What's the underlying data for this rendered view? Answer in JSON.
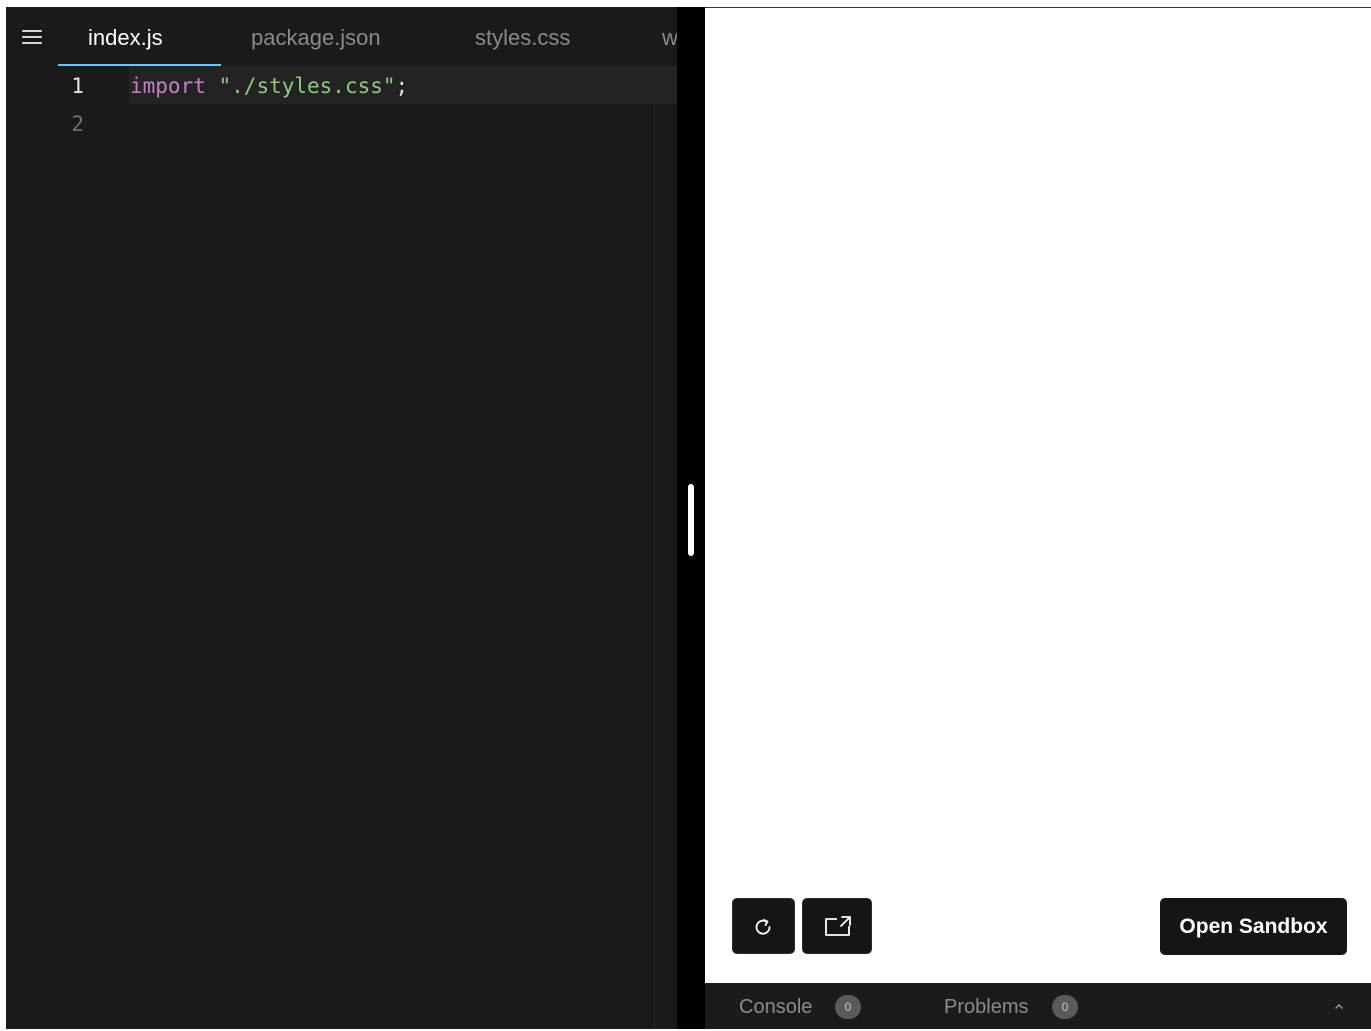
{
  "editor": {
    "tabs": [
      {
        "label": "index.js",
        "active": true
      },
      {
        "label": "package.json",
        "active": false
      },
      {
        "label": "styles.css",
        "active": false
      },
      {
        "label": "w",
        "active": false
      }
    ],
    "line_numbers": [
      "1",
      "2"
    ],
    "code": {
      "line1_keyword": "import",
      "line1_string": "\"./styles.css\"",
      "line1_punct": ";"
    }
  },
  "preview": {
    "refresh_icon": "refresh-icon",
    "new_window_icon": "open-new-window-icon",
    "open_sandbox_label": "Open Sandbox"
  },
  "bottom_bar": {
    "console_label": "Console",
    "console_count": "0",
    "problems_label": "Problems",
    "problems_count": "0",
    "toggle_icon": "chevron-up-icon"
  },
  "colors": {
    "editor_bg": "#1a1a1a",
    "active_tab_underline": "#6cc7f6",
    "keyword": "#c77dca",
    "string": "#8ec97c"
  }
}
